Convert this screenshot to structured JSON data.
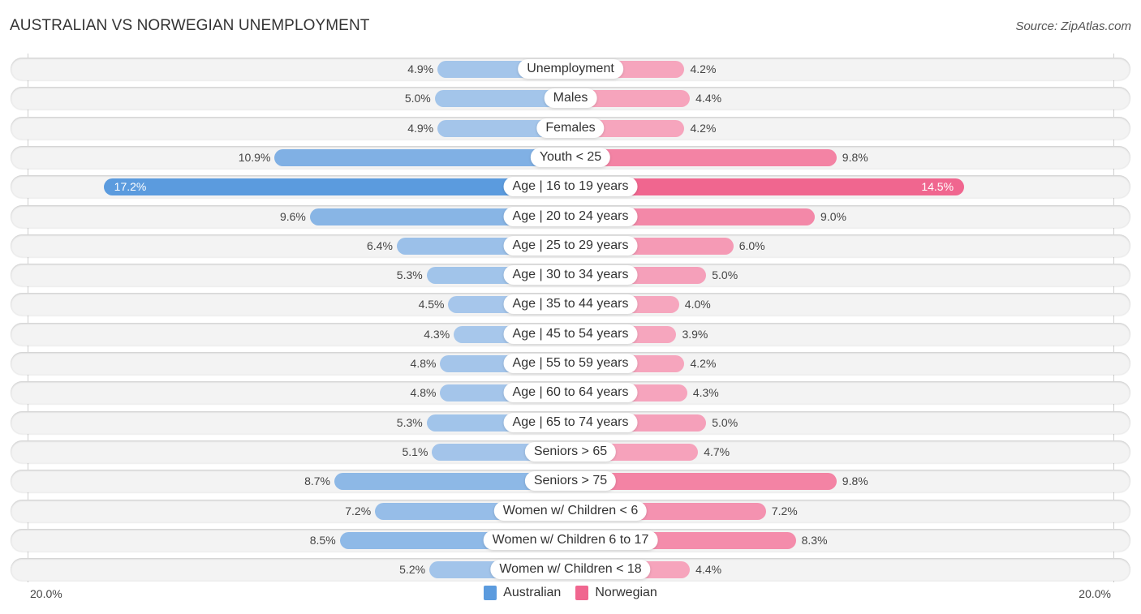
{
  "header": {
    "title": "AUSTRALIAN VS NORWEGIAN UNEMPLOYMENT",
    "source": "Source: ZipAtlas.com"
  },
  "colors": {
    "australian": "#5b9bde",
    "australian_light": "#a9c8eb",
    "norwegian": "#f0668f",
    "norwegian_light": "#f6a6be"
  },
  "chart_data": {
    "type": "bar",
    "orientation": "horizontal-diverging",
    "title": "AUSTRALIAN VS NORWEGIAN UNEMPLOYMENT",
    "xlim": [
      0,
      20.0
    ],
    "axis_left_label": "20.0%",
    "axis_right_label": "20.0%",
    "legend": [
      "Australian",
      "Norwegian"
    ],
    "legend_position": "bottom-center",
    "categories": [
      "Unemployment",
      "Males",
      "Females",
      "Youth < 25",
      "Age | 16 to 19 years",
      "Age | 20 to 24 years",
      "Age | 25 to 29 years",
      "Age | 30 to 34 years",
      "Age | 35 to 44 years",
      "Age | 45 to 54 years",
      "Age | 55 to 59 years",
      "Age | 60 to 64 years",
      "Age | 65 to 74 years",
      "Seniors > 65",
      "Seniors > 75",
      "Women w/ Children < 6",
      "Women w/ Children 6 to 17",
      "Women w/ Children < 18"
    ],
    "series": [
      {
        "name": "Australian",
        "values": [
          4.9,
          5.0,
          4.9,
          10.9,
          17.2,
          9.6,
          6.4,
          5.3,
          4.5,
          4.3,
          4.8,
          4.8,
          5.3,
          5.1,
          8.7,
          7.2,
          8.5,
          5.2
        ],
        "labels": [
          "4.9%",
          "5.0%",
          "4.9%",
          "10.9%",
          "17.2%",
          "9.6%",
          "6.4%",
          "5.3%",
          "4.5%",
          "4.3%",
          "4.8%",
          "4.8%",
          "5.3%",
          "5.1%",
          "8.7%",
          "7.2%",
          "8.5%",
          "5.2%"
        ]
      },
      {
        "name": "Norwegian",
        "values": [
          4.2,
          4.4,
          4.2,
          9.8,
          14.5,
          9.0,
          6.0,
          5.0,
          4.0,
          3.9,
          4.2,
          4.3,
          5.0,
          4.7,
          9.8,
          7.2,
          8.3,
          4.4
        ],
        "labels": [
          "4.2%",
          "4.4%",
          "4.2%",
          "9.8%",
          "14.5%",
          "9.0%",
          "6.0%",
          "5.0%",
          "4.0%",
          "3.9%",
          "4.2%",
          "4.3%",
          "5.0%",
          "4.7%",
          "9.8%",
          "7.2%",
          "8.3%",
          "4.4%"
        ]
      }
    ]
  }
}
